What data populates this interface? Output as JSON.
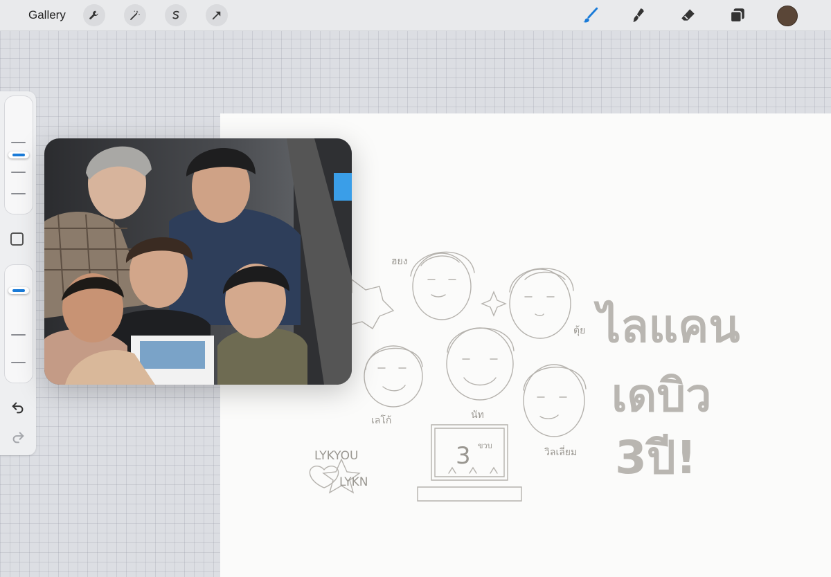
{
  "toolbar": {
    "gallery_label": "Gallery",
    "left_tools": [
      "wrench-icon",
      "magic-wand-icon",
      "selection-icon",
      "transform-arrow-icon"
    ],
    "right_tools": [
      "brush-icon",
      "smudge-icon",
      "eraser-icon",
      "layers-icon"
    ],
    "active_tool": "brush-icon",
    "accent_color": "#1a7bd8",
    "current_color": "#5a4637"
  },
  "sidebar": {
    "brush_size_level": 0.5,
    "opacity_level": 0.85
  },
  "canvas": {
    "sketch_names": [
      "ฮยง",
      "ตุ้ย",
      "เลโก้",
      "นัท",
      "วิลเลี่ยม"
    ],
    "cake_number": "3",
    "cake_suffix": "ขวบ",
    "love_line1": "LYKYOU",
    "love_line2": "LYKN",
    "title_line1": "ไลแคน",
    "title_line2": "เดบิว",
    "title_line3": "3ปี!"
  }
}
